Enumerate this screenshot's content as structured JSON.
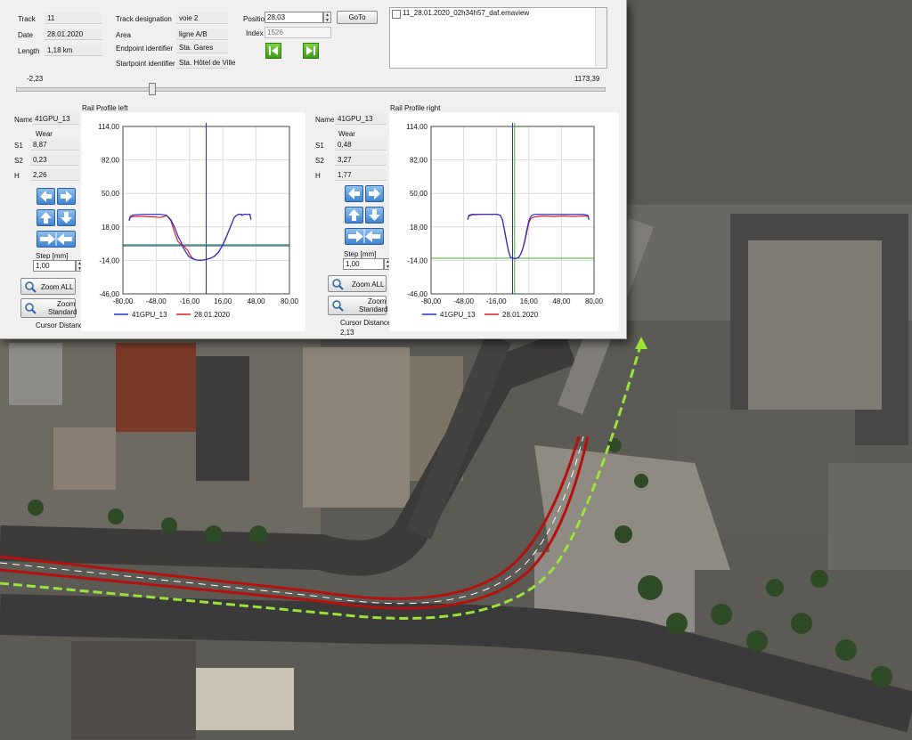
{
  "info": {
    "track_label": "Track",
    "track_value": "11",
    "date_label": "Date",
    "date_value": "28.01.2020",
    "length_label": "Length",
    "length_value": "1,18 km",
    "designation_label": "Track designation",
    "designation_value": "voie 2",
    "area_label": "Area",
    "area_value": "ligne A/B",
    "endpoint_label": "Endpoint identifier",
    "endpoint_value": "Sta. Gares",
    "startpoint_label": "Startpoint identifier",
    "startpoint_value": "Sta. Hôtel de Ville",
    "position_label": "Position",
    "position_value": "28,03",
    "index_label": "Index",
    "index_value": "1526",
    "goto_label": "GoTo",
    "file_name": "11_28.01.2020_02h34h57_daf.emaview"
  },
  "slider": {
    "min_label": "-2,23",
    "max_label": "1173,39",
    "fraction": 0.23
  },
  "left_panel": {
    "name_label": "Name",
    "name_value": "41GPU_13",
    "wear_label": "Wear",
    "s1_label": "S1",
    "s1_value": "8,87",
    "s2_label": "S2",
    "s2_value": "0,23",
    "h_label": "H",
    "h_value": "2,26",
    "step_label": "Step [mm]",
    "step_value": "1,00",
    "zoom_all_label": "Zoom ALL",
    "zoom_standard_label_1": "Zoom",
    "zoom_standard_label_2": "Standard",
    "cursor_label": "Cursor Distance"
  },
  "right_panel": {
    "name_label": "Name",
    "name_value": "41GPU_13",
    "wear_label": "Wear",
    "s1_label": "S1",
    "s1_value": "0,48",
    "s2_label": "S2",
    "s2_value": "3,27",
    "h_label": "H",
    "h_value": "1,77",
    "step_label": "Step [mm]",
    "step_value": "1,00",
    "zoom_all_label": "Zoom ALL",
    "zoom_standard_label_1": "Zoom",
    "zoom_standard_label_2": "Standard",
    "cursor_label": "Cursor Distance",
    "cursor_value": "2,13"
  },
  "chart_data": [
    {
      "type": "line",
      "title": "Rail Profile left",
      "xlim": [
        -80,
        80
      ],
      "ylim": [
        -46,
        114
      ],
      "xticks": [
        "-80,00",
        "-48,00",
        "-16,00",
        "16,00",
        "48,00",
        "80,00"
      ],
      "yticks": [
        "114,00",
        "82,00",
        "50,00",
        "18,00",
        "-14,00",
        "-46,00"
      ],
      "grid": true,
      "legend": "bottom",
      "series": [
        {
          "name": "41GPU_13",
          "color": "#1f2fd1",
          "x": [
            -74,
            -73,
            -70,
            -60,
            -50,
            -44,
            -40,
            -38,
            -34,
            -30,
            -27,
            -24,
            -22,
            -19,
            -17,
            -14,
            -10,
            -6,
            -2,
            0,
            4,
            8,
            12,
            16,
            20,
            24,
            27,
            29,
            31,
            33,
            34,
            34.5,
            36,
            40,
            42,
            43
          ],
          "y": [
            24,
            28,
            29.5,
            30,
            30,
            30,
            29.5,
            29,
            25,
            17,
            9,
            3,
            -2,
            -7,
            -10,
            -12,
            -13.5,
            -14,
            -13.5,
            -13,
            -12,
            -10,
            -6,
            1,
            10,
            20,
            27,
            29,
            30,
            30,
            30,
            29,
            30,
            30,
            30,
            25
          ]
        },
        {
          "name": "28.01.2020",
          "color": "#e02020",
          "x": [
            -74,
            -73,
            -70,
            -60,
            -50,
            -44,
            -40,
            -38,
            -34,
            -30,
            -27,
            -24,
            -22,
            -20,
            -18,
            -16,
            -13,
            -10,
            -6,
            -2,
            0,
            4,
            8,
            12,
            16,
            20,
            24,
            27,
            29,
            31,
            33,
            34,
            34.5,
            36,
            40,
            42,
            43
          ],
          "y": [
            24,
            27,
            28,
            28,
            27.5,
            27,
            28,
            29,
            24,
            12,
            4,
            1,
            0,
            -2,
            -4,
            -8,
            -12,
            -13.5,
            -14,
            -13.5,
            -13,
            -12,
            -10,
            -6,
            1,
            10,
            20,
            27,
            29,
            30,
            30,
            30,
            29,
            30,
            30,
            30,
            25
          ]
        }
      ],
      "guides": [
        {
          "orientation": "vertical",
          "x": 0,
          "color": "#1f2fd1"
        },
        {
          "orientation": "horizontal",
          "y": 0,
          "color": "#1f2fd1"
        },
        {
          "orientation": "horizontal",
          "y": 1,
          "color": "#3fae2a"
        }
      ]
    },
    {
      "type": "line",
      "title": "Rail Profile right",
      "xlim": [
        -80,
        80
      ],
      "ylim": [
        -46,
        114
      ],
      "xticks": [
        "-80,00",
        "-48,00",
        "-16,00",
        "16,00",
        "48,00",
        "80,00"
      ],
      "yticks": [
        "114,00",
        "82,00",
        "50,00",
        "18,00",
        "-14,00",
        "-46,00"
      ],
      "grid": true,
      "legend": "bottom",
      "series": [
        {
          "name": "41GPU_13",
          "color": "#1f2fd1",
          "x": [
            -44,
            -43,
            -40,
            -30,
            -20,
            -15,
            -12,
            -10,
            -8,
            -6,
            -4,
            -2,
            0,
            2,
            4,
            6,
            8,
            10,
            12,
            14,
            16,
            18,
            20,
            22,
            25,
            30,
            40,
            50,
            60,
            70,
            74,
            75
          ],
          "y": [
            25,
            29,
            30,
            30,
            30,
            30,
            29,
            25,
            15,
            5,
            -5,
            -11,
            -12,
            -12,
            -12,
            -11,
            -8,
            -3,
            5,
            15,
            24,
            28,
            29.5,
            30,
            30,
            30,
            30,
            30,
            30,
            30,
            29,
            25
          ]
        },
        {
          "name": "28.01.2020",
          "color": "#e02020",
          "x": [
            -44,
            -43,
            -40,
            -30,
            -20,
            -15,
            -12,
            -10,
            -8,
            -6,
            -4,
            -2,
            0,
            2,
            4,
            6,
            8,
            10,
            12,
            14,
            16,
            18,
            20,
            22,
            25,
            30,
            40,
            50,
            60,
            70,
            74,
            75
          ],
          "y": [
            25,
            28,
            29.5,
            30,
            30,
            30,
            29,
            25,
            15,
            5,
            -5,
            -11,
            -12,
            -12,
            -12,
            -11,
            -8,
            -3,
            4,
            13,
            22,
            26,
            27,
            27.5,
            28,
            28.5,
            28,
            28.5,
            28,
            28.5,
            28,
            25
          ]
        }
      ],
      "guides": [
        {
          "orientation": "vertical",
          "x": 0,
          "color": "#1f2fd1"
        },
        {
          "orientation": "vertical",
          "x": 2,
          "color": "#3fae2a"
        },
        {
          "orientation": "horizontal",
          "y": -12,
          "color": "#1f2fd1"
        },
        {
          "orientation": "horizontal",
          "y": -12,
          "color": "#3fae2a"
        }
      ]
    }
  ],
  "colors": {
    "rail_red": "#b3120f",
    "path_green": "#9be23b",
    "plot_blue": "#1f2fd1",
    "plot_red": "#e02020",
    "plot_green": "#3fae2a"
  }
}
